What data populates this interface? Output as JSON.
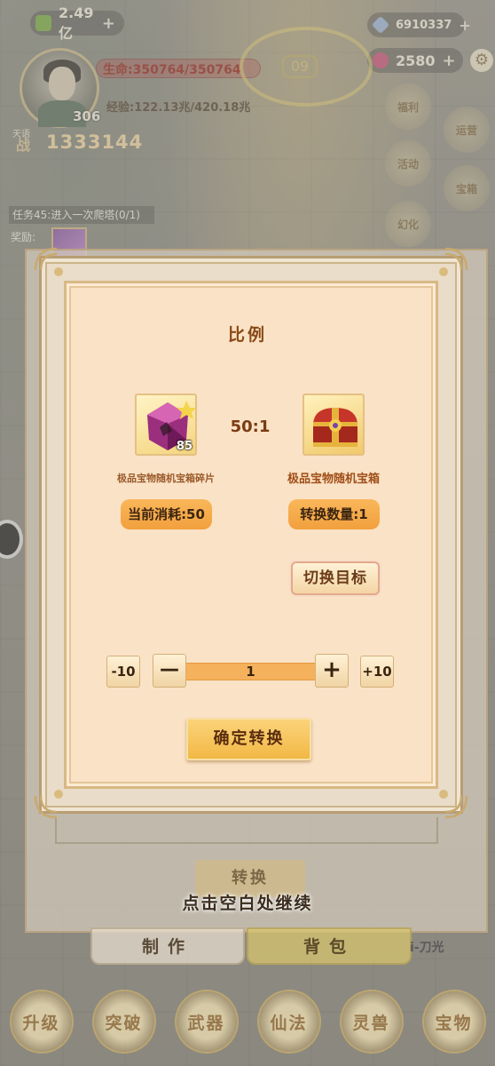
{
  "hud": {
    "gold": "2.49亿",
    "diamonds": "6910337",
    "gems": "2580",
    "hp_text": "生命:350764/350764",
    "exp_text": "经验:122.13兆/420.18兆",
    "level": "306",
    "power_label": "战",
    "power": "1333144",
    "tag_small": "天语",
    "ring_number": "09",
    "plus": "+"
  },
  "side_icons": [
    "福利",
    "运营",
    "活动",
    "宝箱",
    "幻化"
  ],
  "task": {
    "text": "任务45:进入一次爬塔(0/1)",
    "reward_label": "奖励:"
  },
  "modal": {
    "title": "比例",
    "ratio": "50:1",
    "source_item": {
      "name": "极品宝物随机宝箱碎片",
      "qty": "85",
      "consume": "当前消耗:50"
    },
    "target_item": {
      "name": "极品宝物随机宝箱",
      "convert_qty": "转换数量:1"
    },
    "switch_target": "切换目标",
    "stepper": {
      "minus10": "-10",
      "minus": "—",
      "value": "1",
      "plus": "+",
      "plus10": "+10"
    },
    "confirm": "确定转换"
  },
  "background": {
    "convert_button": "转换",
    "continue_hint": "点击空白处继续",
    "tab_make": "制作",
    "tab_bag": "背包",
    "blade_label": "i-刀光"
  },
  "bottom_nav": [
    "升级",
    "突破",
    "武器",
    "仙法",
    "灵兽",
    "宝物"
  ],
  "colors": {
    "modal_bg": "#fae2c6",
    "pill": "#f5b15b",
    "title": "#8a4a17",
    "confirm": "#f4bd4d"
  }
}
